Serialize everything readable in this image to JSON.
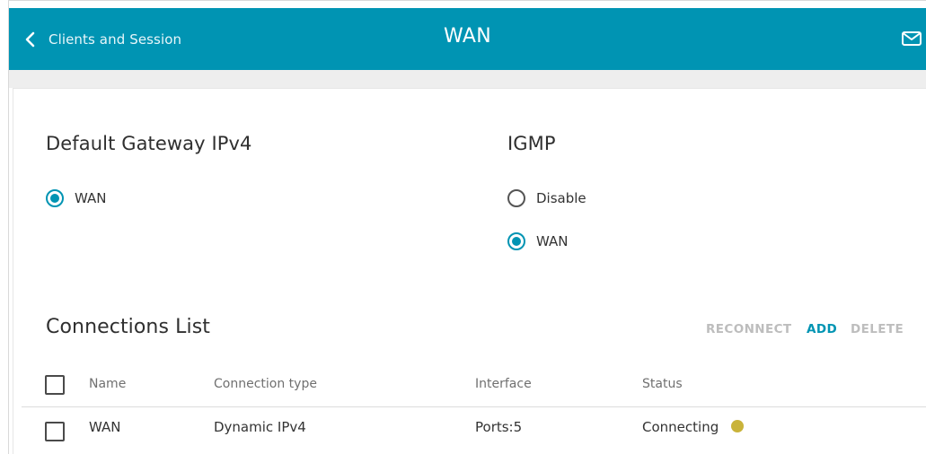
{
  "header": {
    "back_label": "Clients and Session",
    "title": "WAN",
    "mail_icon": "envelope-icon"
  },
  "gateway": {
    "title": "Default Gateway IPv4",
    "options": [
      {
        "label": "WAN",
        "checked": true
      }
    ]
  },
  "igmp": {
    "title": "IGMP",
    "options": [
      {
        "label": "Disable",
        "checked": false
      },
      {
        "label": "WAN",
        "checked": true
      }
    ]
  },
  "connections": {
    "title": "Connections List",
    "actions": {
      "reconnect": "RECONNECT",
      "add": "ADD",
      "delete": "DELETE"
    },
    "columns": [
      "Name",
      "Connection type",
      "Interface",
      "Status"
    ],
    "rows": [
      {
        "name": "WAN",
        "type": "Dynamic IPv4",
        "interface": "Ports:5",
        "status": "Connecting",
        "status_color": "#c9b33a"
      }
    ]
  },
  "colors": {
    "accent": "#0094b3",
    "status_connecting": "#c9b33a"
  }
}
